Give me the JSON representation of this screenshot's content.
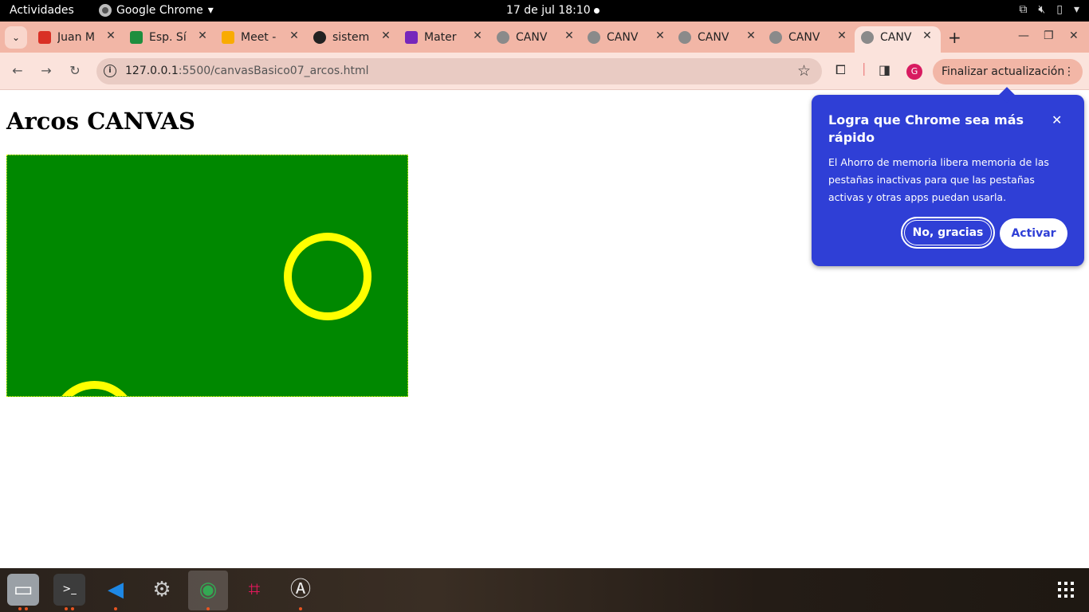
{
  "topbar": {
    "activities": "Actividades",
    "app_name": "Google Chrome",
    "clock": "17 de jul  18:10"
  },
  "tabs": [
    {
      "title": "Juan M",
      "favicon": "gmail-icon",
      "color": "#d93025"
    },
    {
      "title": "Esp. Sí",
      "favicon": "classroom-icon",
      "color": "#1e8e3e"
    },
    {
      "title": "Meet -",
      "favicon": "meet-icon",
      "color": "#f9ab00"
    },
    {
      "title": "sistem",
      "favicon": "github-icon",
      "color": "#222222"
    },
    {
      "title": "Mater",
      "favicon": "forms-icon",
      "color": "#7627bb"
    },
    {
      "title": "CANV",
      "favicon": "globe-icon",
      "color": "#8a8a8a"
    },
    {
      "title": "CANV",
      "favicon": "globe-icon",
      "color": "#8a8a8a"
    },
    {
      "title": "CANV",
      "favicon": "globe-icon",
      "color": "#8a8a8a"
    },
    {
      "title": "CANV",
      "favicon": "globe-icon",
      "color": "#8a8a8a"
    },
    {
      "title": "CANV",
      "favicon": "globe-icon",
      "color": "#8a8a8a",
      "active": true
    }
  ],
  "omnibox": {
    "host": "127.0.0.1",
    "path": ":5500/canvasBasico07_arcos.html"
  },
  "toolbar": {
    "profile_initial": "G",
    "update_label": "Finalizar actualización"
  },
  "page": {
    "title": "Arcos CANVAS",
    "canvas": {
      "background": "#008800",
      "stroke": "#ffff00"
    }
  },
  "popup": {
    "title": "Logra que Chrome sea más rápido",
    "body": "El Ahorro de memoria libera memoria de las pestañas inactivas para que las pestañas activas y otras apps puedan usarla.",
    "decline": "No, gracias",
    "accept": "Activar",
    "background": "#2f3fd6"
  },
  "dock": {
    "items": [
      "files-icon",
      "terminal-icon",
      "vscode-icon",
      "settings-icon",
      "chrome-icon",
      "screenshot-icon",
      "software-updater-icon"
    ]
  }
}
